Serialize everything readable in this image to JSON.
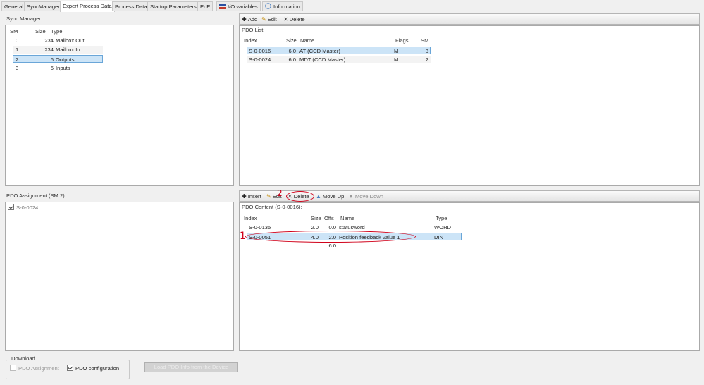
{
  "tabs": [
    {
      "label": "General"
    },
    {
      "label": "SyncManager"
    },
    {
      "label": "Expert Process Data",
      "active": true
    },
    {
      "label": "Process Data"
    },
    {
      "label": "Startup Parameters"
    },
    {
      "label": "EoE"
    },
    {
      "label": "I/O variables",
      "icon": "io-variables-icon"
    },
    {
      "label": "Information",
      "icon": "information-icon"
    }
  ],
  "sync_manager": {
    "title": "Sync Manager",
    "headers": {
      "sm": "SM",
      "size": "Size",
      "type": "Type"
    },
    "rows": [
      {
        "sm": "0",
        "size": "234",
        "type": "Mailbox Out"
      },
      {
        "sm": "1",
        "size": "234",
        "type": "Mailbox In"
      },
      {
        "sm": "2",
        "size": "6",
        "type": "Outputs",
        "selected": true
      },
      {
        "sm": "3",
        "size": "6",
        "type": "Inputs"
      }
    ]
  },
  "pdo_list_toolbar": {
    "add": "Add",
    "edit": "Edit",
    "delete": "Delete"
  },
  "pdo_list": {
    "title": "PDO List",
    "headers": {
      "index": "Index",
      "size": "Size",
      "name": "Name",
      "flags": "Flags",
      "sm": "SM"
    },
    "rows": [
      {
        "index": "S-0-0016",
        "size": "6.0",
        "name": "AT (CCD Master)",
        "flags": "M",
        "sm": "3",
        "selected": true
      },
      {
        "index": "S-0-0024",
        "size": "6.0",
        "name": "MDT (CCD Master)",
        "flags": "M",
        "sm": "2"
      }
    ]
  },
  "pdo_assignment": {
    "title": "PDO Assignment (SM 2)",
    "items": [
      {
        "label": "S-0-0024",
        "checked": true
      }
    ]
  },
  "pdo_content_toolbar": {
    "insert": "Insert",
    "edit": "Edit",
    "delete": "Delete",
    "move_up": "Move Up",
    "move_down": "Move Down"
  },
  "pdo_content": {
    "title": "PDO Content (S-0-0016):",
    "headers": {
      "index": "Index",
      "size": "Size",
      "offs": "Offs",
      "name": "Name",
      "type": "Type"
    },
    "rows": [
      {
        "index": "S-0-0135",
        "size": "2.0",
        "offs": "0.0",
        "name": "statusword",
        "type": "WORD"
      },
      {
        "index": "S-0-0051",
        "size": "4.0",
        "offs": "2.0",
        "name": "Position feedback value 1",
        "type": "DINT",
        "selected": true
      },
      {
        "index": "",
        "size": "",
        "offs": "6.0",
        "name": "",
        "type": ""
      }
    ]
  },
  "download": {
    "title": "Download",
    "pdo_assignment": {
      "label": "PDO Assignment",
      "checked": false,
      "enabled": false
    },
    "pdo_configuration": {
      "label": "PDO configuration",
      "checked": true,
      "enabled": true
    }
  },
  "load_button": {
    "label": "Load PDO Info from the Device"
  },
  "annotations": {
    "marker_1": "1",
    "marker_2": "2"
  },
  "colors": {
    "selection": "#cce4f7",
    "annotation": "#d0021b"
  }
}
